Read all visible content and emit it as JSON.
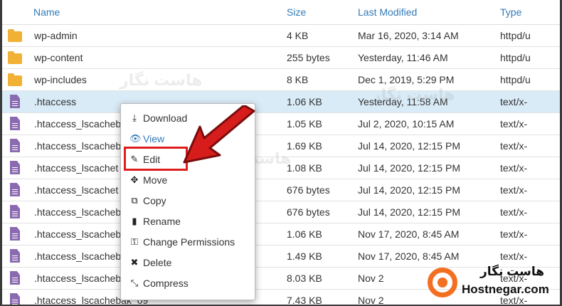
{
  "table": {
    "headers": {
      "name": "Name",
      "size": "Size",
      "modified": "Last Modified",
      "type": "Type"
    },
    "rows": [
      {
        "name": "wp-admin",
        "size": "4 KB",
        "modified": "Mar 16, 2020, 3:14 AM",
        "type": "httpd/u",
        "icon": "folder-icon"
      },
      {
        "name": "wp-content",
        "size": "255 bytes",
        "modified": "Yesterday, 11:46 AM",
        "type": "httpd/u",
        "icon": "folder-icon"
      },
      {
        "name": "wp-includes",
        "size": "8 KB",
        "modified": "Dec 1, 2019, 5:29 PM",
        "type": "httpd/u",
        "icon": "folder-icon"
      },
      {
        "name": ".htaccess",
        "size": "1.06 KB",
        "modified": "Yesterday, 11:58 AM",
        "type": "text/x-",
        "icon": "file-icon",
        "selected": true
      },
      {
        "name": ".htaccess_lscacheb",
        "size": "1.05 KB",
        "modified": "Jul 2, 2020, 10:15 AM",
        "type": "text/x-",
        "icon": "file-icon"
      },
      {
        "name": ".htaccess_lscacheb",
        "size": "1.69 KB",
        "modified": "Jul 14, 2020, 12:15 PM",
        "type": "text/x-",
        "icon": "file-icon"
      },
      {
        "name": ".htaccess_lscachet",
        "size": "1.08 KB",
        "modified": "Jul 14, 2020, 12:15 PM",
        "type": "text/x-",
        "icon": "file-icon"
      },
      {
        "name": ".htaccess_lscachet",
        "size": "676 bytes",
        "modified": "Jul 14, 2020, 12:15 PM",
        "type": "text/x-",
        "icon": "file-icon"
      },
      {
        "name": ".htaccess_lscacheb",
        "size": "676 bytes",
        "modified": "Jul 14, 2020, 12:15 PM",
        "type": "text/x-",
        "icon": "file-icon"
      },
      {
        "name": ".htaccess_lscacheb",
        "size": "1.06 KB",
        "modified": "Nov 17, 2020, 8:45 AM",
        "type": "text/x-",
        "icon": "file-icon"
      },
      {
        "name": ".htaccess_lscacheb",
        "size": "1.49 KB",
        "modified": "Nov 17, 2020, 8:45 AM",
        "type": "text/x-",
        "icon": "file-icon"
      },
      {
        "name": ".htaccess_lscacheb",
        "size": "8.03 KB",
        "modified": "Nov 2",
        "type": "text/x-",
        "icon": "file-icon"
      },
      {
        "name": ".htaccess_lscachebak_09",
        "size": "7.43 KB",
        "modified": "Nov 2",
        "type": "text/x-",
        "icon": "file-icon"
      }
    ]
  },
  "context_menu": {
    "items": [
      {
        "label": "Download",
        "icon": "download-icon",
        "glyph": "⤓"
      },
      {
        "label": "View",
        "icon": "eye-icon",
        "glyph": "👁"
      },
      {
        "label": "Edit",
        "icon": "pencil-icon",
        "glyph": "✎"
      },
      {
        "label": "Move",
        "icon": "move-icon",
        "glyph": "✥"
      },
      {
        "label": "Copy",
        "icon": "copy-icon",
        "glyph": "⧉"
      },
      {
        "label": "Rename",
        "icon": "rename-icon",
        "glyph": "▮"
      },
      {
        "label": "Change Permissions",
        "icon": "key-icon",
        "glyph": "⚿"
      },
      {
        "label": "Delete",
        "icon": "delete-icon",
        "glyph": "✖"
      },
      {
        "label": "Compress",
        "icon": "compress-icon",
        "glyph": "⤡"
      }
    ]
  },
  "watermark": {
    "brand_fa": "هاست نگار",
    "brand_en": "Hostnegar.com"
  },
  "colors": {
    "header_link": "#337ab7",
    "selected_row": "#d9ebf7",
    "highlight": "#e01e1e",
    "folder": "#f0b134",
    "file": "#8a6ab0",
    "brand": "#f36f21"
  }
}
